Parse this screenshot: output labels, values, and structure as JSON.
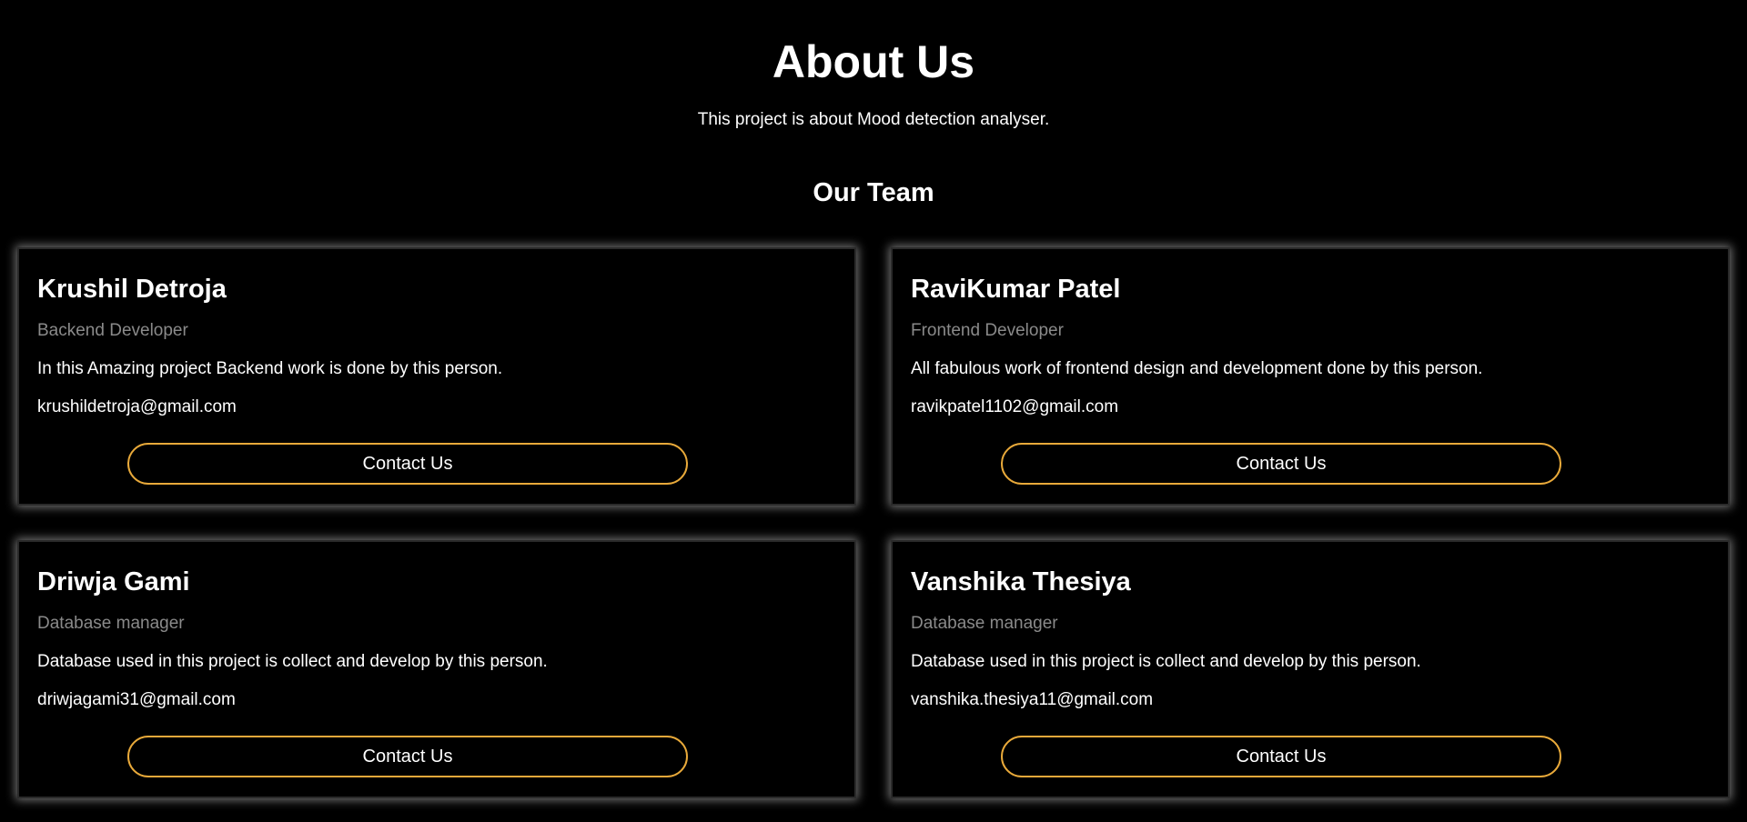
{
  "hero": {
    "title": "About Us",
    "subtitle": "This project is about Mood detection analyser."
  },
  "team": {
    "title": "Our Team",
    "members": [
      {
        "name": "Krushil Detroja",
        "role": "Backend Developer",
        "description": "In this Amazing project Backend work is done by this person.",
        "email": "krushildetroja@gmail.com",
        "button_label": "Contact Us"
      },
      {
        "name": "RaviKumar Patel",
        "role": "Frontend Developer",
        "description": "All fabulous work of frontend design and development done by this person.",
        "email": "ravikpatel1102@gmail.com",
        "button_label": "Contact Us"
      },
      {
        "name": "Driwja Gami",
        "role": "Database manager",
        "description": "Database used in this project is collect and develop by this person.",
        "email": "driwjagami31@gmail.com",
        "button_label": "Contact Us"
      },
      {
        "name": "Vanshika Thesiya",
        "role": "Database manager",
        "description": "Database used in this project is collect and develop by this person.",
        "email": "vanshika.thesiya11@gmail.com",
        "button_label": "Contact Us"
      }
    ]
  },
  "colors": {
    "background": "#000000",
    "text": "#ffffff",
    "muted": "#8a8a8a",
    "accent": "#e8a93a"
  }
}
